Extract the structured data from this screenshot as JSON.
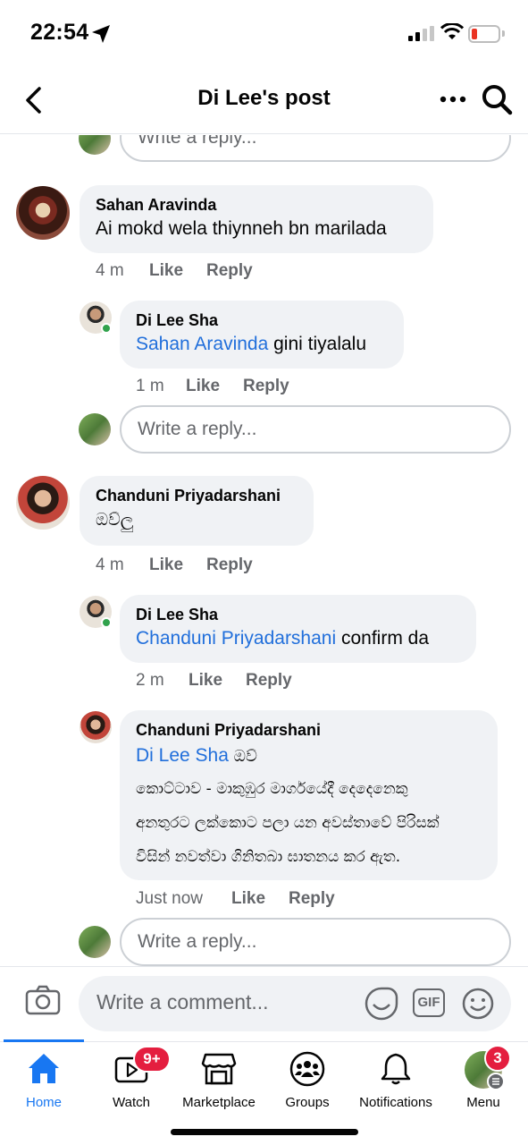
{
  "status_bar": {
    "time": "22:54"
  },
  "header": {
    "title": "Di Lee's post"
  },
  "thread": {
    "top_reply_placeholder": "Write a reply...",
    "comments": [
      {
        "author": "Sahan Aravinda",
        "text": "Ai mokd wela thiynneh bn marilada",
        "age": "4 m",
        "like": "Like",
        "reply": "Reply",
        "replies": [
          {
            "author": "Di Lee Sha",
            "mention": "Sahan Aravinda",
            "text": " gini tiyalalu",
            "age": "1 m",
            "like": "Like",
            "reply": "Reply"
          }
        ],
        "reply_placeholder": "Write a reply..."
      },
      {
        "author": "Chanduni Priyadarshani",
        "text": "ඔව්ලු",
        "age": "4 m",
        "like": "Like",
        "reply": "Reply",
        "replies": [
          {
            "author": "Di Lee Sha",
            "mention": "Chanduni Priyadarshani",
            "text": " confirm da",
            "age": "2 m",
            "like": "Like",
            "reply": "Reply"
          },
          {
            "author": "Chanduni Priyadarshani",
            "mention": "Di Lee Sha",
            "text": " ඔව්",
            "lines": [
              "කොට්ටාව - මාකුඹුර මාර්ගයේදී දෙදෙනෙකු",
              "අනතුරට ලක්කොට පලා යන අවස්තාවේ පිරිසක්",
              "විසින් නවත්වා ගිනිතබා ඝාතනය කර ඇත."
            ],
            "age": "Just now",
            "like": "Like",
            "reply": "Reply"
          }
        ],
        "reply_placeholder": "Write a reply..."
      }
    ]
  },
  "composer": {
    "placeholder": "Write a comment...",
    "gif_label": "GIF"
  },
  "tabs": [
    {
      "label": "Home",
      "icon": "home-icon",
      "active": true
    },
    {
      "label": "Watch",
      "icon": "watch-icon",
      "badge": "9+"
    },
    {
      "label": "Marketplace",
      "icon": "marketplace-icon"
    },
    {
      "label": "Groups",
      "icon": "groups-icon"
    },
    {
      "label": "Notifications",
      "icon": "bell-icon"
    },
    {
      "label": "Menu",
      "icon": "avatar-menu",
      "badge": "3"
    }
  ],
  "colors": {
    "accent": "#1877f2",
    "mention": "#216fdb",
    "badge": "#e41e3f",
    "bubble": "#f0f2f5",
    "online": "#31a24c"
  }
}
